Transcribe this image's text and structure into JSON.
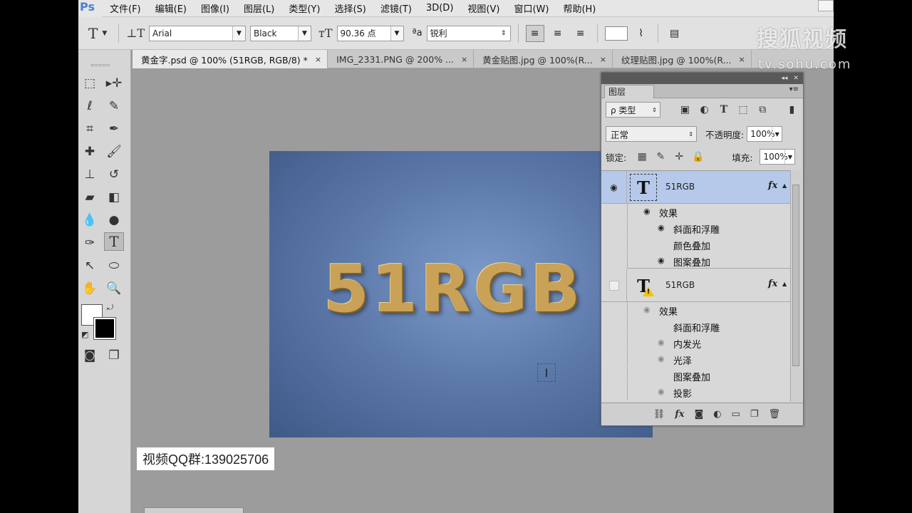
{
  "app": {
    "logo": "Ps"
  },
  "menu": [
    "文件(F)",
    "编辑(E)",
    "图像(I)",
    "图层(L)",
    "类型(Y)",
    "选择(S)",
    "滤镜(T)",
    "3D(D)",
    "视图(V)",
    "窗口(W)",
    "帮助(H)"
  ],
  "options": {
    "tool_glyph": "T",
    "orient_glyph": "⊥T",
    "font_family": "Arial",
    "font_style": "Black",
    "size_icon": "тT",
    "font_size": "90.36 点",
    "aa_label": "ªa",
    "antialias": "锐利"
  },
  "tabs": [
    {
      "label": "黄金字.psd @ 100% (51RGB, RGB/8) *",
      "close": "×"
    },
    {
      "label": "IMG_2331.PNG @ 200% ...",
      "close": "×"
    },
    {
      "label": "黄金贴图.jpg @ 100%(R...",
      "close": "×"
    },
    {
      "label": "纹理贴图.jpg @ 100%(R...",
      "close": "×"
    }
  ],
  "canvas": {
    "text": "51RGB",
    "cursor": "I"
  },
  "overlay": {
    "watermark": "搜狐视频",
    "watermark_url": "tv.sohu.com",
    "qq": "视频QQ群:139025706"
  },
  "layers_panel": {
    "tab": "图层",
    "filter": "ρ 类型",
    "blend_mode": "正常",
    "opacity_label": "不透明度:",
    "opacity": "100%",
    "lock_label": "锁定:",
    "fill_label": "填充:",
    "fill": "100%",
    "layers": [
      {
        "name": "51RGB",
        "fx": "fx",
        "effects_label": "效果",
        "effects": [
          {
            "name": "斜面和浮雕",
            "visible": true
          },
          {
            "name": "颜色叠加",
            "visible": false
          },
          {
            "name": "图案叠加",
            "visible": true
          }
        ]
      },
      {
        "name": "51RGB",
        "fx": "fx",
        "effects_label": "效果",
        "effects": [
          {
            "name": "斜面和浮雕",
            "visible": false
          },
          {
            "name": "内发光",
            "visible": true
          },
          {
            "name": "光泽",
            "visible": true
          },
          {
            "name": "图案叠加",
            "visible": false
          },
          {
            "name": "投影",
            "visible": true
          }
        ]
      }
    ]
  },
  "colors": {
    "selection": "#b6c9ea",
    "canvas_bg": "#5d7aab",
    "gold": "#c9a257"
  }
}
